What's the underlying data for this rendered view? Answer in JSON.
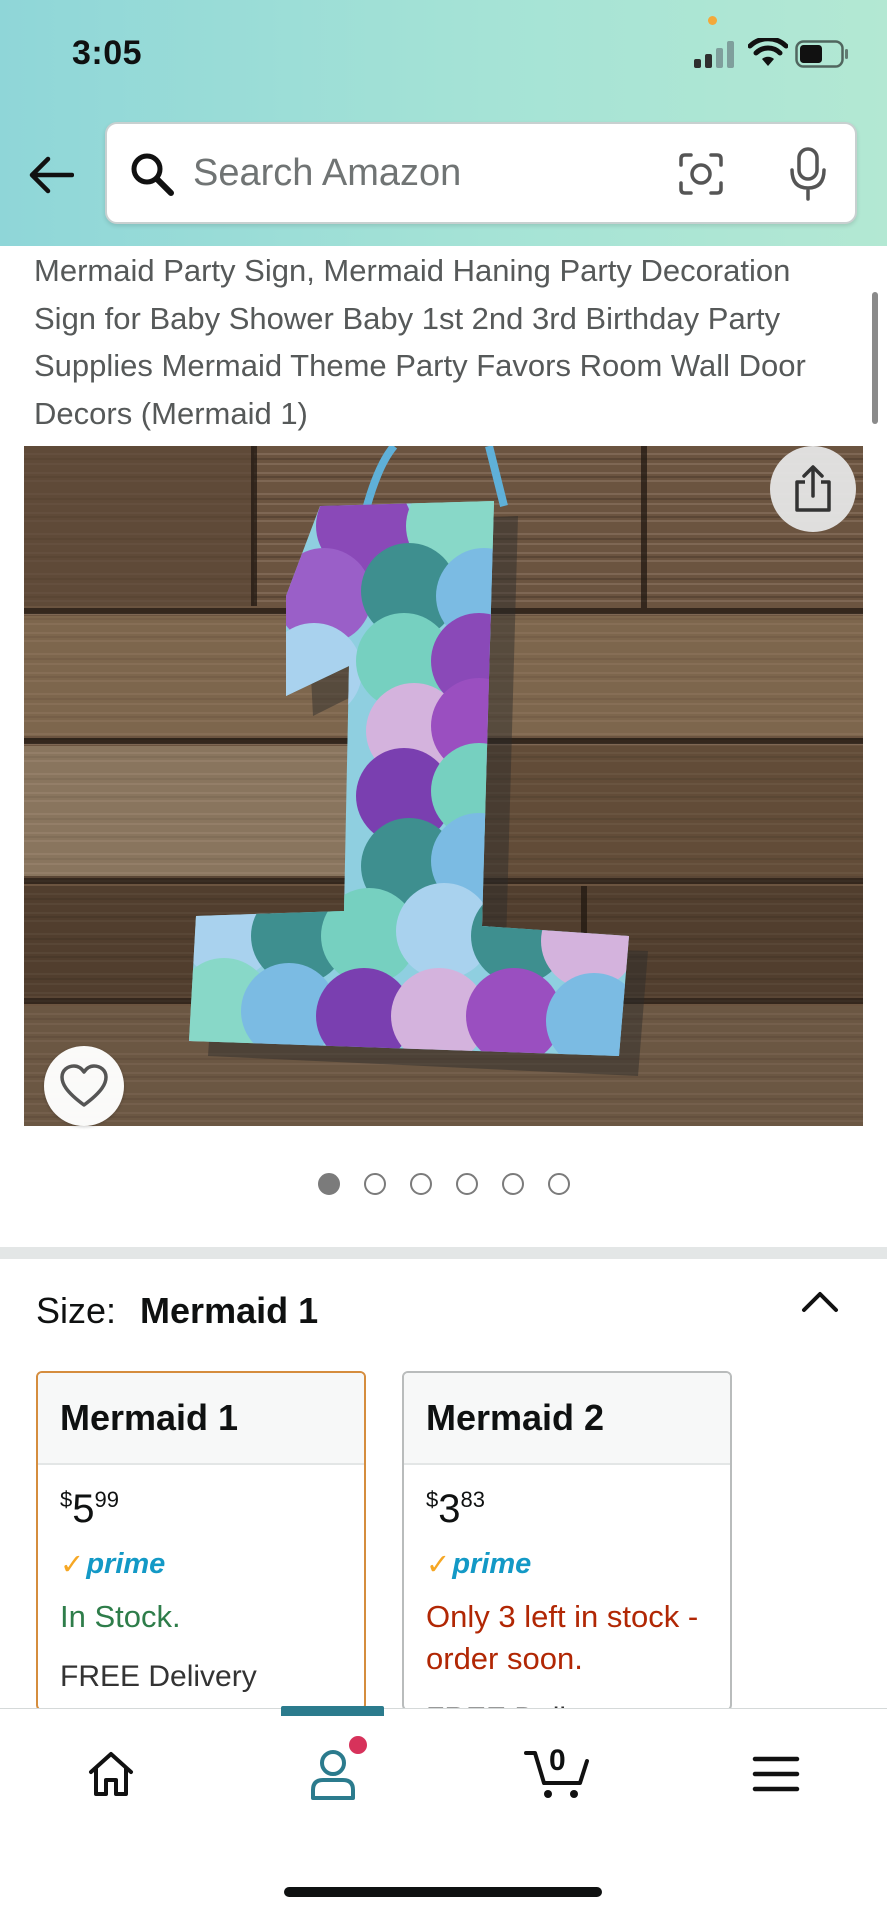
{
  "status_bar": {
    "time": "3:05"
  },
  "search": {
    "placeholder": "Search Amazon"
  },
  "product": {
    "title": "Mermaid Party Sign, Mermaid Haning Party Decoration Sign for Baby Shower Baby 1st 2nd 3rd Birthday Party Supplies Mermaid Theme Party Favors Room Wall Door Decors (Mermaid 1)",
    "image_count": 6,
    "active_image_index": 0
  },
  "size_selector": {
    "label": "Size:",
    "selected": "Mermaid 1",
    "options": [
      {
        "name": "Mermaid 1",
        "price_symbol": "$",
        "price_whole": "5",
        "price_fraction": "99",
        "prime_label": "prime",
        "stock": "In Stock.",
        "delivery": "FREE Delivery"
      },
      {
        "name": "Mermaid 2",
        "price_symbol": "$",
        "price_whole": "3",
        "price_fraction": "83",
        "prime_label": "prime",
        "stock": "Only 3 left in stock - order soon.",
        "delivery": "FREE Delivery"
      }
    ]
  },
  "tabbar": {
    "cart_count": "0",
    "items": [
      "home-icon",
      "account-icon",
      "cart-icon",
      "menu-icon"
    ],
    "active": "account"
  },
  "colors": {
    "header_gradient_start": "#8fd6d8",
    "header_gradient_end": "#b3e8d3",
    "in_stock": "#2e7d4a",
    "low_stock": "#b12704",
    "prime_blue": "#1399c6",
    "prime_check": "#f6a724",
    "selected_border": "#d58d3e",
    "active_tab": "#2b7b8d"
  }
}
